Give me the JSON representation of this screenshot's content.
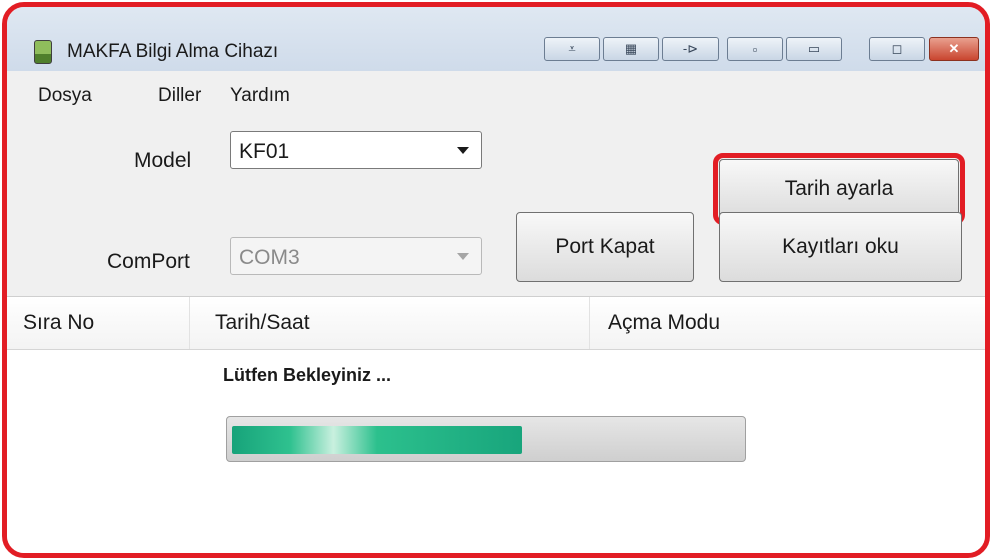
{
  "window": {
    "title": "MAKFA Bilgi Alma Cihazı",
    "controls": [
      {
        "name": "collapse-icon",
        "glyph": "⩡"
      },
      {
        "name": "keyboard-icon",
        "glyph": "▦"
      },
      {
        "name": "pin-icon",
        "glyph": "-⊳"
      },
      {
        "name": "minimize-small-icon",
        "glyph": "▫"
      },
      {
        "name": "minimize-icon",
        "glyph": "▭"
      },
      {
        "name": "maximize-icon",
        "glyph": "◻"
      },
      {
        "name": "close-icon",
        "glyph": "✕"
      }
    ]
  },
  "menu": [
    "Dosya",
    "Diller",
    "Yardım"
  ],
  "form": {
    "model_label": "Model",
    "model_value": "KF01",
    "comport_label": "ComPort",
    "comport_value": "COM3"
  },
  "buttons": {
    "set_date": "Tarih ayarla",
    "close_port": "Port Kapat",
    "read_records": "Kayıtları oku"
  },
  "table": {
    "columns": [
      "Sıra No",
      "Tarih/Saat",
      "Açma Modu"
    ]
  },
  "status": {
    "message": "Lütfen Bekleyiniz ...",
    "progress": 0.57
  },
  "colors": {
    "highlight": "#e21d24",
    "progress_fill": "#1fb384"
  }
}
